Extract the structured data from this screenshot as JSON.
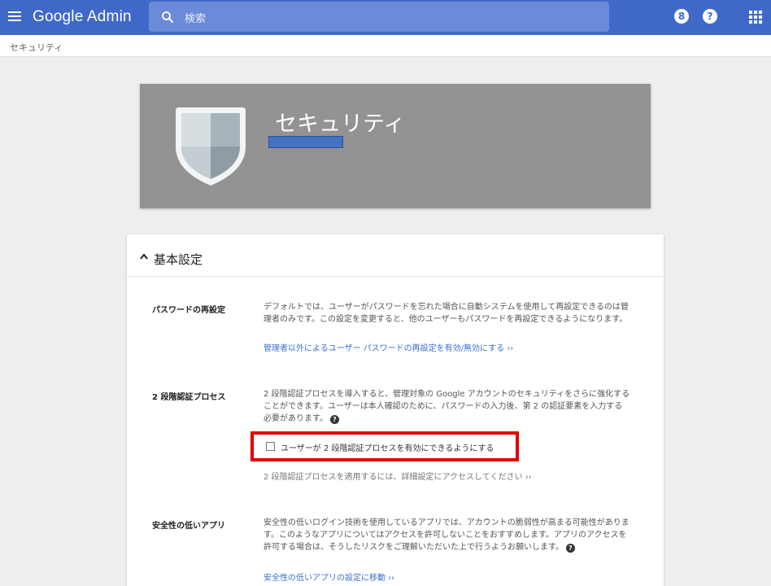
{
  "header": {
    "app_name": "Google Admin",
    "search_placeholder": "検索",
    "account_icon_glyph": "8",
    "help_icon_glyph": "?"
  },
  "breadcrumb": "セキュリティ",
  "hero": {
    "title": "セキュリティ"
  },
  "section": {
    "title": "基本設定",
    "rows": [
      {
        "label": "パスワードの再設定",
        "desc_lines": [
          "デフォルトでは、ユーザーがパスワードを忘れた場合に自動システムを使用して再設定できるのは管",
          "理者のみです。この設定を変更すると、他のユーザーもパスワードを再設定できるようになります。"
        ],
        "link": "管理者以外によるユーザー パスワードの再設定を有効/無効にする ››"
      },
      {
        "label": "2 段階認証プロセス",
        "desc_lines": [
          "2 段階認証プロセスを導入すると、管理対象の Google アカウントのセキュリティをさらに強化する",
          "ことができます。ユーザーは本人確認のために、パスワードの入力後、第 2 の認証要素を入力する",
          "必要があります。"
        ],
        "checkbox_label": "ユーザーが 2 段階認証プロセスを有効にできるようにする",
        "checkbox_checked": false,
        "link": "2 段階認証プロセスを適用するには、詳細設定にアクセスしてください ››"
      },
      {
        "label": "安全性の低いアプリ",
        "desc_lines": [
          "安全性の低いログイン技術を使用しているアプリでは、アカウントの脆弱性が高まる可能性がありま",
          "す。このようなアプリについてはアクセスを許可しないことをおすすめします。アプリのアクセスを",
          "許可する場合は、そうしたリスクをご理解いただいた上で行うようお願いします。"
        ],
        "link": "安全性の低いアプリの設定に移動 ››"
      }
    ]
  },
  "colors": {
    "topbar": "#3f69c9",
    "link": "#3b6fd0",
    "highlight": "#e00000"
  }
}
